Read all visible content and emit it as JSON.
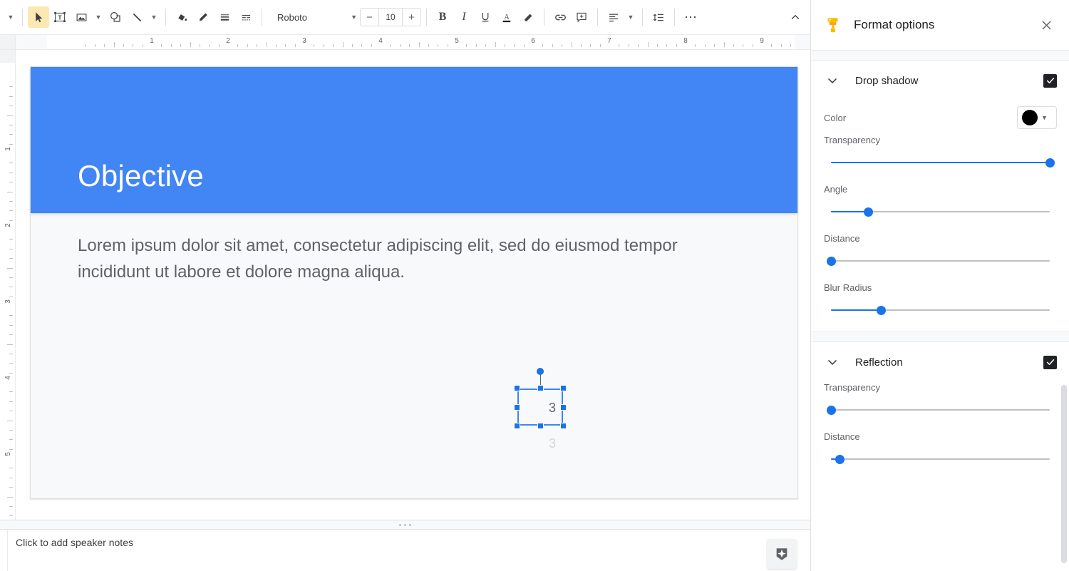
{
  "app": {
    "name": "Google Slides Editor"
  },
  "toolbar": {
    "undo_dropdown": "more-options",
    "items": [
      {
        "name": "select-tool",
        "icon": "cursor-arrow-icon",
        "label": "Select",
        "active": true
      },
      {
        "name": "textbox-tool",
        "icon": "text-box-icon",
        "label": "Text box",
        "active": false
      },
      {
        "name": "image-tool",
        "icon": "image-icon",
        "label": "Insert image",
        "active": false
      },
      {
        "name": "shape-tool",
        "icon": "shape-icon",
        "label": "Shape",
        "active": false
      },
      {
        "name": "line-tool",
        "icon": "line-icon",
        "label": "Line",
        "active": false
      },
      {
        "name": "fill-color",
        "icon": "paint-bucket-icon",
        "label": "Fill color",
        "active": false
      },
      {
        "name": "border-color",
        "icon": "pencil-icon",
        "label": "Border color",
        "active": false
      },
      {
        "name": "border-weight",
        "icon": "border-weight-icon",
        "label": "Border weight",
        "active": false
      },
      {
        "name": "border-dash",
        "icon": "border-dash-icon",
        "label": "Border dash",
        "active": false
      }
    ],
    "font_name": "Roboto",
    "font_size": "10",
    "decrease_font_label": "−",
    "increase_font_label": "+",
    "bold_label": "B",
    "italic_label": "I",
    "underline_label": "U",
    "text_color_label": "A",
    "highlight_label": "highlight-icon",
    "link_label": "link-icon",
    "comment_label": "add-comment-icon",
    "align_label": "align-icon",
    "line_spacing_label": "line-spacing-icon",
    "more_label": "⋯",
    "collapse_label": "collapse-toolbar-icon"
  },
  "rulers": {
    "horizontal_numbers": [
      "1",
      "2",
      "3",
      "4",
      "5",
      "6",
      "7",
      "8",
      "9"
    ],
    "vertical_numbers": [
      "1",
      "2",
      "3",
      "4",
      "5"
    ],
    "unit": "inches"
  },
  "slide": {
    "title": "Objective",
    "body": "Lorem ipsum dolor sit amet, consectetur adipiscing elit, sed do eiusmod tempor incididunt ut labore et dolore magna aliqua.",
    "header_color": "#4285f4",
    "background_color": "#f8f9fa",
    "selected_object": {
      "text": "3",
      "reflection_text": "3",
      "selected": true,
      "handle_color": "#1a73e8"
    }
  },
  "notes": {
    "placeholder": "Click to add speaker notes",
    "explore_button": "explore-icon"
  },
  "panel": {
    "icon": "format-paint-roller-icon",
    "title": "Format options",
    "close_label": "×",
    "sections": [
      {
        "id": "drop_shadow",
        "name": "Drop shadow",
        "expanded": true,
        "checked": true,
        "color_label": "Color",
        "color_value": "#000000",
        "sliders": [
          {
            "label": "Transparency",
            "value": 100
          },
          {
            "label": "Angle",
            "value": 17
          },
          {
            "label": "Distance",
            "value": 0
          },
          {
            "label": "Blur Radius",
            "value": 23
          }
        ]
      },
      {
        "id": "reflection",
        "name": "Reflection",
        "expanded": true,
        "checked": true,
        "sliders": [
          {
            "label": "Transparency",
            "value": 0
          },
          {
            "label": "Distance",
            "value": 4
          }
        ]
      }
    ],
    "accent_color": "#1a73e8"
  }
}
